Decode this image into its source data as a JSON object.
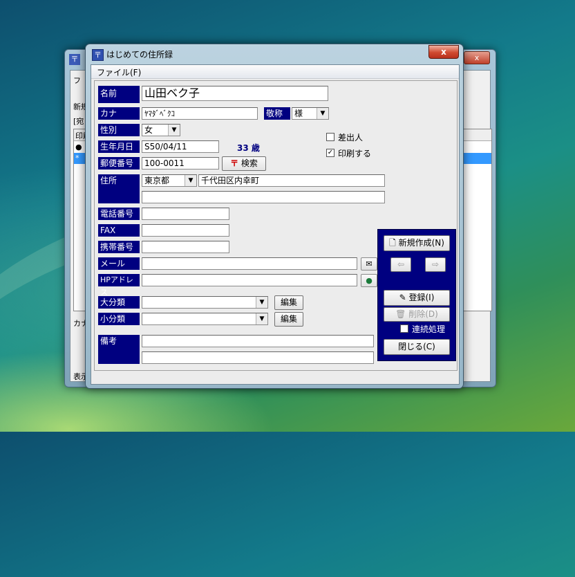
{
  "background_window": {
    "title_icon": "〒",
    "close_label": "x",
    "fragments": [
      "フ",
      "新規",
      "[宛",
      "印刷",
      "●",
      "*",
      "カナ",
      "表示"
    ]
  },
  "window": {
    "title_icon": "〒",
    "title": "はじめての住所録",
    "close_label": "x"
  },
  "menu": {
    "file": "ファイル(F)"
  },
  "form": {
    "name_label": "名前",
    "name_value": "山田ベク子",
    "kana_label": "カナ",
    "kana_value": "ﾔﾏﾀﾞﾍﾞｸｺ",
    "honorific_label": "敬称",
    "honorific_value": "様",
    "gender_label": "性別",
    "gender_value": "女",
    "birth_label": "生年月日",
    "birth_value": "S50/04/11",
    "age_text": "33 歳",
    "postal_label": "郵便番号",
    "postal_value": "100-0011",
    "search_button": "検索",
    "address_label": "住所",
    "prefecture_value": "東京都",
    "address1_value": "千代田区内幸町",
    "address2_value": "",
    "phone_label": "電話番号",
    "phone_value": "",
    "fax_label": "FAX",
    "fax_value": "",
    "mobile_label": "携帯番号",
    "mobile_value": "",
    "mail_label": "メール",
    "mail_value": "",
    "hp_label": "HPアドレス",
    "hp_value": "",
    "major_label": "大分類",
    "major_value": "",
    "minor_label": "小分類",
    "minor_value": "",
    "edit_button": "編集",
    "notes_label": "備考",
    "notes1_value": "",
    "notes2_value": "",
    "sender_label": "差出人",
    "sender_checked": false,
    "print_label": "印刷する",
    "print_checked": true
  },
  "actions": {
    "new_button": "新規作成(N)",
    "register_button": "登録(I)",
    "delete_button": "削除(D)",
    "continuous_label": "連続処理",
    "continuous_checked": false,
    "close_button": "閉じる(C)"
  },
  "colors": {
    "label_bg": "#000080",
    "age_text": "#000080",
    "close_red": "#d04a30"
  }
}
